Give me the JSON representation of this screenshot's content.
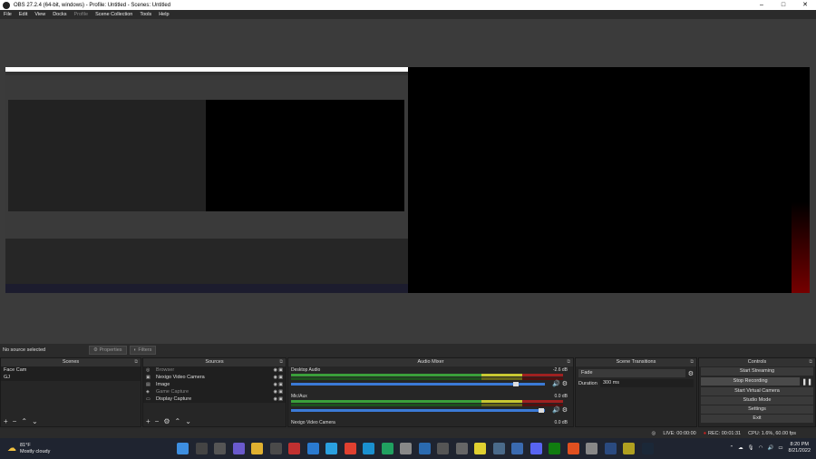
{
  "window": {
    "title": "OBS 27.2.4 (64-bit, windows) - Profile: Untitled - Scenes: Untitled",
    "minimize": "–",
    "maximize": "□",
    "close": "✕"
  },
  "menu": [
    "File",
    "Edit",
    "View",
    "Docks",
    "Profile",
    "Scene Collection",
    "Tools",
    "Help"
  ],
  "source_bar": {
    "status": "No source selected",
    "properties_label": "Properties",
    "filters_label": "Filters"
  },
  "scenes": {
    "title": "Scenes",
    "items": [
      "Face Cam",
      "GJ"
    ]
  },
  "sources": {
    "title": "Sources",
    "items": [
      {
        "name": "Browser",
        "dim": true
      },
      {
        "name": "Nexigo Video Camera",
        "dim": false
      },
      {
        "name": "Image",
        "dim": false
      },
      {
        "name": "Game Capture",
        "dim": true
      },
      {
        "name": "Display Capture",
        "dim": false
      }
    ]
  },
  "mixer": {
    "title": "Audio Mixer",
    "tracks": [
      {
        "name": "Desktop Audio",
        "db": "-2.6 dB",
        "level": 0.88
      },
      {
        "name": "Mic/Aux",
        "db": "0.0 dB",
        "level": 1.0
      },
      {
        "name": "Nexigo Video Camera",
        "db": "0.0 dB",
        "level": 1.0
      }
    ]
  },
  "transitions": {
    "title": "Scene Transitions",
    "type": "Fade",
    "duration_label": "Duration",
    "duration_value": "300 ms"
  },
  "controls": {
    "title": "Controls",
    "buttons": [
      "Start Streaming",
      "Stop Recording",
      "Start Virtual Camera",
      "Studio Mode",
      "Settings",
      "Exit"
    ]
  },
  "status": {
    "live": "LIVE: 00:00:00",
    "rec": "REC: 00:01:31",
    "cpu": "CPU: 1.6%, 60.00 fps"
  },
  "taskbar": {
    "temperature": "81°F",
    "weather": "Mostly cloudy",
    "time": "8:20 PM",
    "date": "8/21/2022"
  },
  "colors": {
    "accent": "#3b7ad6",
    "rec_red": "#d02020",
    "meter_green": "#3aa03a"
  }
}
